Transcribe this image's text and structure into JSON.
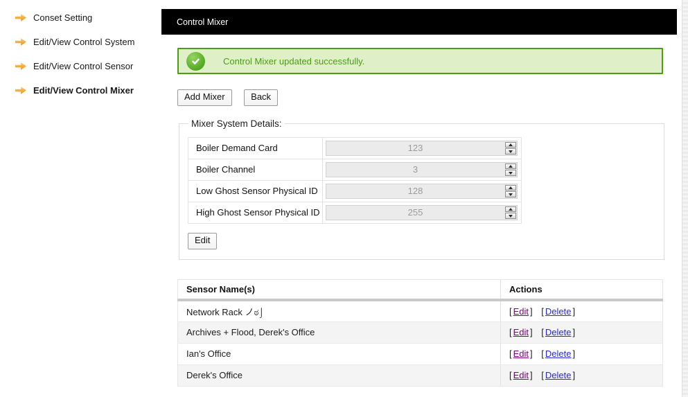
{
  "sidebar": {
    "items": [
      {
        "label": "Conset Setting",
        "active": false
      },
      {
        "label": "Edit/View Control System",
        "active": false
      },
      {
        "label": "Edit/View Control Sensor",
        "active": false
      },
      {
        "label": "Edit/View Control Mixer",
        "active": true
      }
    ]
  },
  "titlebar": {
    "title": "Control Mixer"
  },
  "alert": {
    "icon": "check-circle-icon",
    "message": "Control Mixer updated successfully."
  },
  "toolbar": {
    "add_mixer": "Add Mixer",
    "back": "Back"
  },
  "details": {
    "legend": "Mixer System Details:",
    "fields": [
      {
        "label": "Boiler Demand Card",
        "value": "123"
      },
      {
        "label": "Boiler Channel",
        "value": "3"
      },
      {
        "label": "Low Ghost Sensor Physical ID",
        "value": "128"
      },
      {
        "label": "High Ghost Sensor Physical ID",
        "value": "255"
      }
    ],
    "edit": "Edit"
  },
  "sensor_table": {
    "headers": {
      "name": "Sensor Name(s)",
      "actions": "Actions"
    },
    "bracket_open": "[",
    "bracket_close": "]",
    "rows": [
      {
        "name": "Network Rack ノಠ⌡",
        "edit": "Edit",
        "delete": "Delete"
      },
      {
        "name": "Archives + Flood, Derek's Office",
        "edit": "Edit",
        "delete": "Delete"
      },
      {
        "name": "Ian's Office",
        "edit": "Edit",
        "delete": "Delete"
      },
      {
        "name": "Derek's Office",
        "edit": "Edit",
        "delete": "Delete"
      }
    ]
  },
  "colors": {
    "accent_orange": "#F5A11C",
    "success_border": "#4E9C14",
    "success_bg": "#DFF0C8",
    "success_text": "#4C9A16",
    "titlebar_bg": "#000000",
    "link_edit": "#800080",
    "link_delete": "#2727DD"
  }
}
